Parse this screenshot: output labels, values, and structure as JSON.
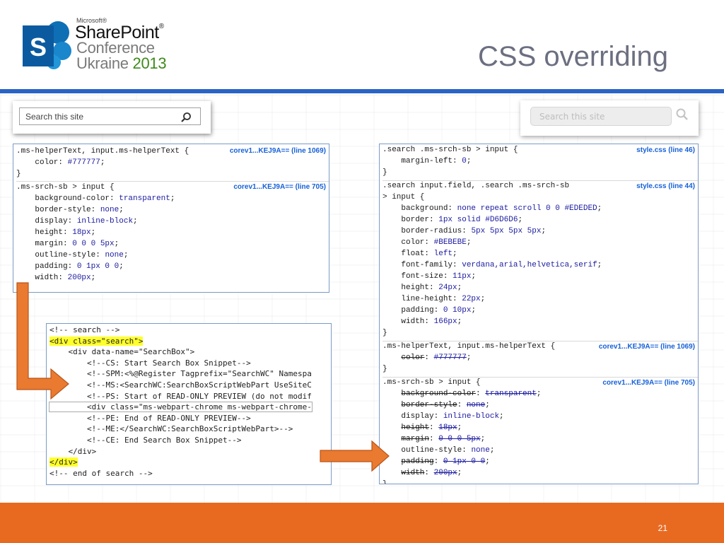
{
  "logo": {
    "microsoft": "Microsoft®",
    "sharepoint": "SharePoint",
    "trademark": "®",
    "conference": "Conference",
    "ukraine": "Ukraine",
    "year": "2013",
    "icon": "sharepoint-s-logo"
  },
  "title": "CSS overriding",
  "page_number": "21",
  "search_left": {
    "placeholder": "Search this site",
    "icon": "search-icon"
  },
  "search_right": {
    "placeholder": "Search this site",
    "icon": "search-icon"
  },
  "css_left": {
    "rule1": {
      "selector": ".ms-helperText, input.ms-helperText {",
      "source": "corev1...KEJ9A== (line 1069)",
      "props": [
        {
          "name": "color",
          "value": "#777777"
        }
      ],
      "close": "}"
    },
    "rule2": {
      "selector": ".ms-srch-sb > input {",
      "source": "corev1...KEJ9A== (line 705)",
      "props": [
        {
          "name": "background-color",
          "value": "transparent"
        },
        {
          "name": "border-style",
          "value": "none"
        },
        {
          "name": "display",
          "value": "inline-block"
        },
        {
          "name": "height",
          "value": "18px"
        },
        {
          "name": "margin",
          "value": "0 0 0 5px"
        },
        {
          "name": "outline-style",
          "value": "none"
        },
        {
          "name": "padding",
          "value": "0 1px 0 0"
        },
        {
          "name": "width",
          "value": "200px"
        }
      ]
    }
  },
  "css_right": {
    "rule1": {
      "selector": ".search .ms-srch-sb > input {",
      "source": "style.css (line 46)",
      "props": [
        {
          "name": "margin-left",
          "value": "0"
        }
      ],
      "close": "}"
    },
    "rule2": {
      "selector1": ".search input.field, .search .ms-srch-sb",
      "selector2": "> input {",
      "source": "style.css (line 44)",
      "props": [
        {
          "name": "background",
          "value": "none repeat scroll 0 0 #EDEDED"
        },
        {
          "name": "border",
          "value": "1px solid #D6D6D6"
        },
        {
          "name": "border-radius",
          "value": "5px 5px 5px 5px"
        },
        {
          "name": "color",
          "value": "#BEBEBE"
        },
        {
          "name": "float",
          "value": "left"
        },
        {
          "name": "font-family",
          "value": "verdana,arial,helvetica,serif"
        },
        {
          "name": "font-size",
          "value": "11px"
        },
        {
          "name": "height",
          "value": "24px"
        },
        {
          "name": "line-height",
          "value": "22px"
        },
        {
          "name": "padding",
          "value": "0 10px"
        },
        {
          "name": "width",
          "value": "166px"
        }
      ],
      "close": "}"
    },
    "rule3": {
      "selector": ".ms-helperText, input.ms-helperText {",
      "source": "corev1...KEJ9A== (line 1069)",
      "props": [
        {
          "name": "color",
          "value": "#777777",
          "struck": true
        }
      ],
      "close": "}"
    },
    "rule4": {
      "selector": ".ms-srch-sb > input {",
      "source": "corev1...KEJ9A== (line 705)",
      "props": [
        {
          "name": "background-color",
          "value": "transparent",
          "struck": true
        },
        {
          "name": "border-style",
          "value": "none",
          "struck": true
        },
        {
          "name": "display",
          "value": "inline-block",
          "struck": false
        },
        {
          "name": "height",
          "value": "18px",
          "struck": true
        },
        {
          "name": "margin",
          "value": "0 0 0 5px",
          "struck": true
        },
        {
          "name": "outline-style",
          "value": "none",
          "struck": false
        },
        {
          "name": "padding",
          "value": "0 1px 0 0",
          "struck": true
        },
        {
          "name": "width",
          "value": "200px",
          "struck": true
        }
      ],
      "close": "}"
    }
  },
  "html_source": {
    "lines": [
      "<!-- search -->",
      "<div class=\"search\">",
      "    <div data-name=\"SearchBox\">",
      "        <!--CS: Start Search Box Snippet-->",
      "        <!--SPM:<%@Register Tagprefix=\"SearchWC\" Namespa",
      "        <!--MS:<SearchWC:SearchBoxScriptWebPart UseSiteC",
      "        <!--PS: Start of READ-ONLY PREVIEW (do not modif",
      "        <div class=\"ms-webpart-chrome ms-webpart-chrome-",
      "        <!--PE: End of READ-ONLY PREVIEW-->",
      "        <!--ME:</SearchWC:SearchBoxScriptWebPart>-->",
      "        <!--CE: End Search Box Snippet-->",
      "    </div>",
      "</div>",
      "<!-- end of search -->"
    ]
  }
}
